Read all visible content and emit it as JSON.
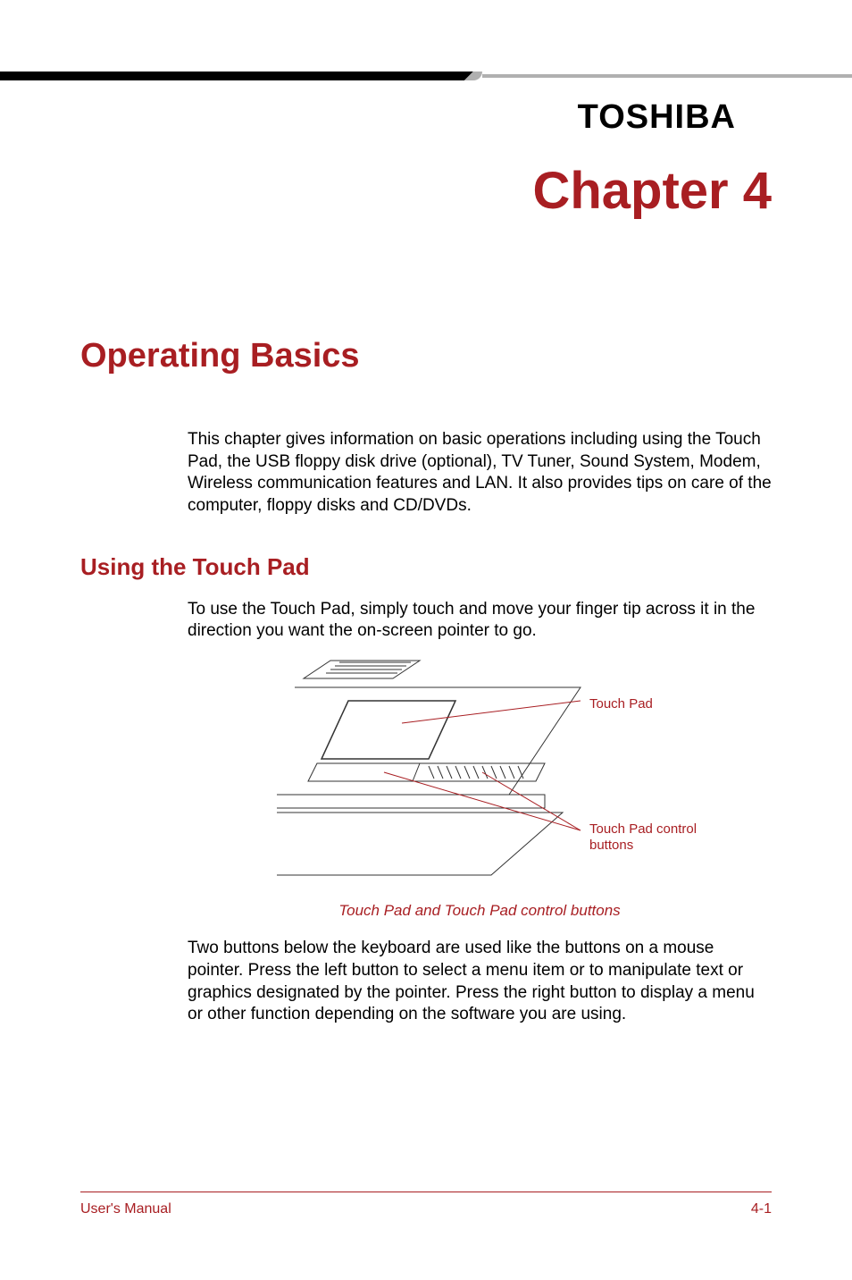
{
  "brand": "TOSHIBA",
  "chapter": "Chapter 4",
  "section_title": "Operating Basics",
  "intro_paragraph": "This chapter gives information on basic operations including using the Touch Pad, the USB floppy disk drive (optional), TV Tuner, Sound System, Modem, Wireless communication features and LAN. It also provides tips on care of the computer, floppy disks and CD/DVDs.",
  "subsection_title": "Using the Touch Pad",
  "touchpad_paragraph1": "To use the Touch Pad, simply touch and move your finger tip across it in the direction you want the on-screen pointer to go.",
  "diagram": {
    "label_touchpad": "Touch Pad",
    "label_buttons": "Touch Pad control buttons",
    "caption": "Touch Pad and Touch Pad control buttons"
  },
  "touchpad_paragraph2": "Two buttons below the keyboard are used like the buttons on a mouse pointer. Press the left button to select a menu item or to manipulate text or graphics designated by the pointer. Press the right button to display a menu or other function depending on the software you are using.",
  "footer": {
    "left": "User's Manual",
    "right": "4-1"
  },
  "colors": {
    "accent": "#a81e22"
  }
}
